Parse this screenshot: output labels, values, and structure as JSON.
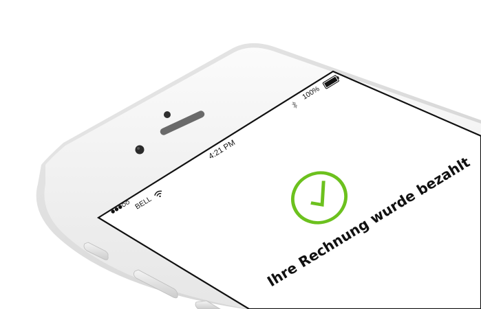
{
  "status_bar": {
    "carrier": "BELL",
    "time": "4:21 PM",
    "battery": "100%",
    "signal_bars": 5,
    "signal_filled": 3
  },
  "screen": {
    "message": "Ihre Rechnung wurde bezahlt",
    "accent_color": "#6cc11e",
    "icon": "checkmark-circle-icon"
  }
}
